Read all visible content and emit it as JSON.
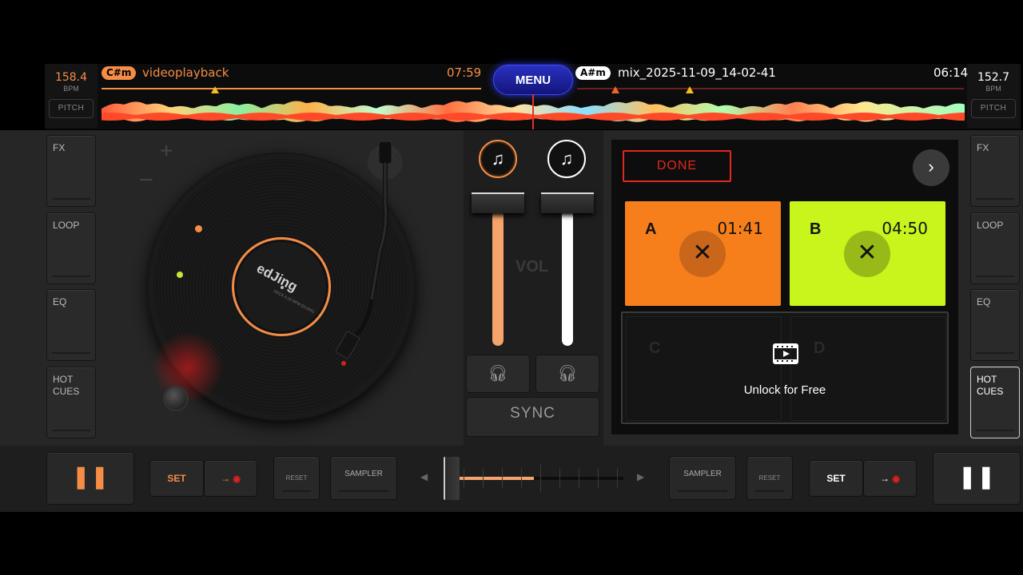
{
  "colors": {
    "deck_a_accent": "#f58d46",
    "deck_b_accent": "#ffffff",
    "pad_a": "#f77f1b",
    "pad_b": "#c8f51c",
    "done_red": "#e0281e",
    "menu_blue": "#2a30c0"
  },
  "deck_a": {
    "bpm": "158.4",
    "bpm_unit": "BPM",
    "pitch_label": "PITCH",
    "key": "C#m",
    "track_title": "videoplayback",
    "time": "07:59",
    "label_logo": "edJing",
    "label_sub": "DECK A  33 RPM  EDJING"
  },
  "deck_b": {
    "bpm": "152.7",
    "bpm_unit": "BPM",
    "pitch_label": "PITCH",
    "key": "A#m",
    "track_title": "mix_2025-11-09_14-02-41",
    "time": "06:14"
  },
  "menu_label": "MENU",
  "left_side_buttons": [
    {
      "label": "FX"
    },
    {
      "label": "LOOP"
    },
    {
      "label": "EQ"
    },
    {
      "label": "HOT\nCUES"
    }
  ],
  "right_side_buttons": [
    {
      "label": "FX"
    },
    {
      "label": "LOOP"
    },
    {
      "label": "EQ"
    },
    {
      "label": "HOT\nCUES"
    }
  ],
  "mixer": {
    "vol_label": "VOL",
    "sync_label": "SYNC",
    "add_track_icon": "music-note-add-icon",
    "headphone_icon": "headphones-icon",
    "volume_a": 1.0,
    "volume_b": 1.0
  },
  "sampler": {
    "done_label": "DONE",
    "next_icon": "chevron-right-icon",
    "pads": [
      {
        "letter": "A",
        "time": "01:41",
        "clear_icon": "close-icon"
      },
      {
        "letter": "B",
        "time": "04:50",
        "clear_icon": "close-icon"
      }
    ],
    "locked_pads": [
      {
        "letter": "C"
      },
      {
        "letter": "D"
      }
    ],
    "unlock_icon": "video-unlock-icon",
    "unlock_label": "Unlock for Free"
  },
  "bottom": {
    "deck_a": {
      "play_icon": "pause-icon",
      "set_label": "SET",
      "arrow_icon": "arrow-right-icon",
      "record_icon": "record-dot-icon",
      "reset_label": "RESET",
      "sampler_label": "SAMPLER"
    },
    "deck_b": {
      "play_icon": "pause-icon",
      "set_label": "SET",
      "arrow_icon": "arrow-right-icon",
      "record_icon": "record-dot-icon",
      "reset_label": "RESET",
      "sampler_label": "SAMPLER"
    },
    "crossfader_position": 0.0,
    "crossfader_left_icon": "triangle-left-icon",
    "crossfader_right_icon": "triangle-right-icon"
  }
}
